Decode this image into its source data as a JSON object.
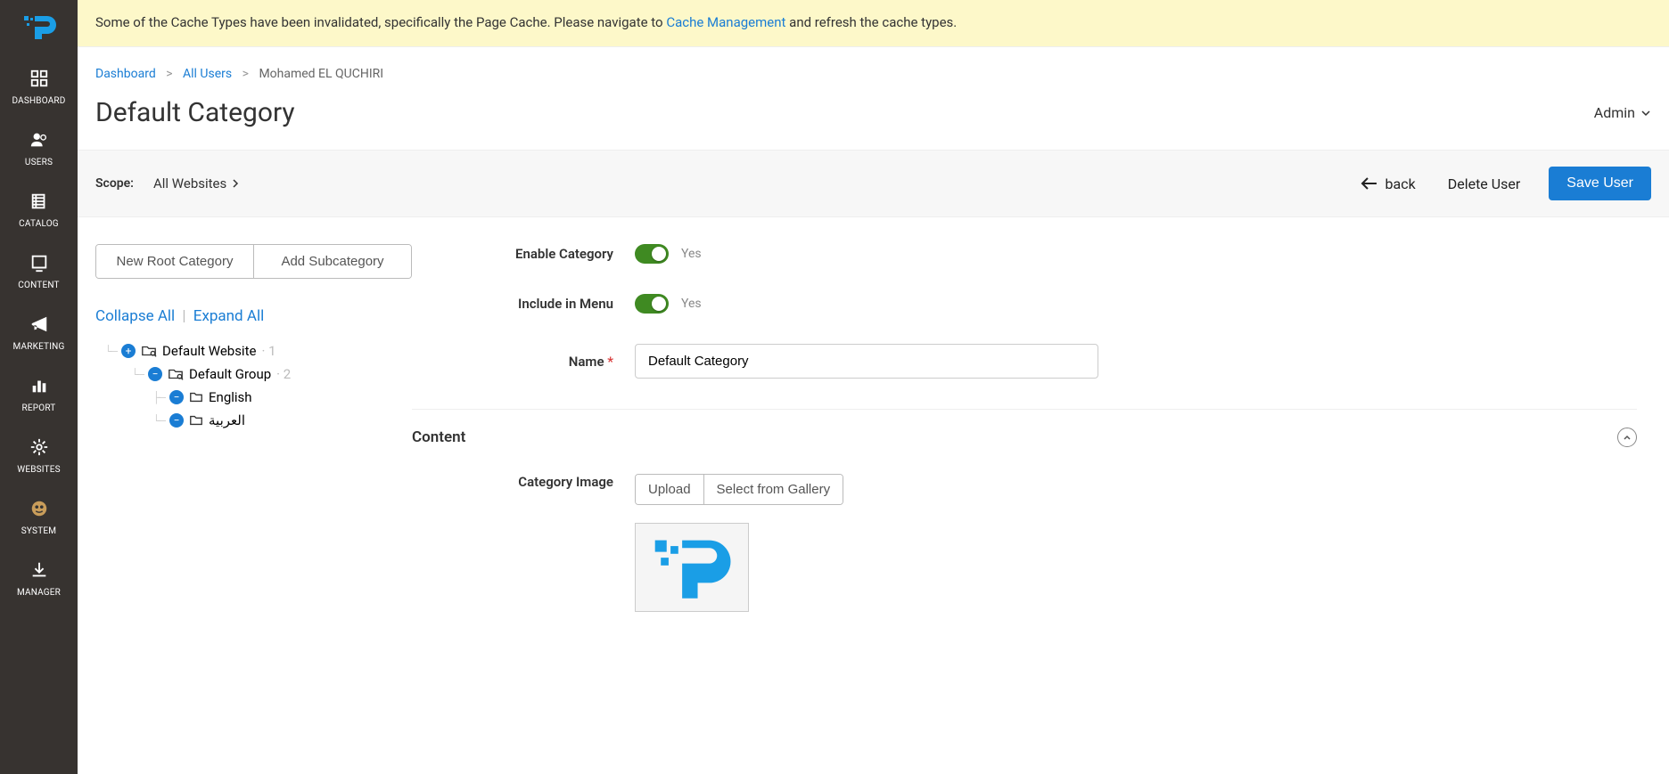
{
  "sidebar": {
    "items": [
      {
        "label": "DASHBOARD"
      },
      {
        "label": "USERS"
      },
      {
        "label": "CATALOG"
      },
      {
        "label": "CONTENT"
      },
      {
        "label": "MARKETING"
      },
      {
        "label": "REPORT"
      },
      {
        "label": "WEBSITES"
      },
      {
        "label": "SYSTEM"
      },
      {
        "label": "MANAGER"
      }
    ]
  },
  "notice": {
    "prefix": "Some of the Cache Types have been invalidated, specifically the Page Cache. Please navigate to ",
    "link": "Cache Management",
    "suffix": " and refresh the cache types."
  },
  "breadcrumb": {
    "dashboard": "Dashboard",
    "all_users": "All Users",
    "current": "Mohamed EL QUCHIRI",
    "sep": ">"
  },
  "page_title": "Default Category",
  "admin_menu": "Admin",
  "scope": {
    "label": "Scope:",
    "value": "All Websites"
  },
  "actions": {
    "back": "back",
    "delete": "Delete User",
    "save": "Save User"
  },
  "left_panel": {
    "new_root": "New Root Category",
    "add_sub": "Add Subcategory",
    "collapse": "Collapse All",
    "expand": "Expand All"
  },
  "tree": {
    "website": "Default Website",
    "website_count": "1",
    "group": "Default Group",
    "group_count": "2",
    "english": "English",
    "arabic": "العربية"
  },
  "form": {
    "enable_label": "Enable Category",
    "enable_value": "Yes",
    "include_label": "Include in Menu",
    "include_value": "Yes",
    "name_label": "Name",
    "name_value": "Default Category"
  },
  "section_content": {
    "title": "Content",
    "image_label": "Category Image",
    "upload": "Upload",
    "select_gallery": "Select from Gallery"
  }
}
